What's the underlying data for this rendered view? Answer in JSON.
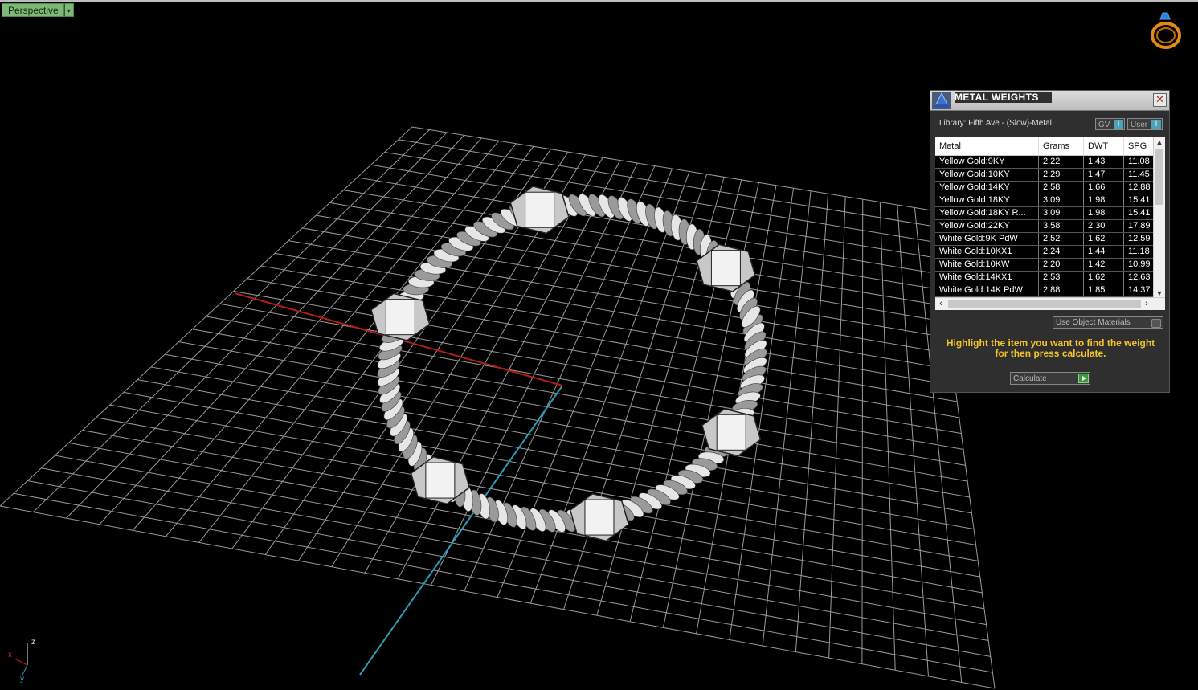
{
  "viewport": {
    "label": "Perspective",
    "dropdown_glyph": "▾",
    "axis": {
      "x": "x",
      "y": "y",
      "z": "z"
    },
    "logo_icon": "ring-icon"
  },
  "panel": {
    "title": "METAL WEIGHTS",
    "close_glyph": "✕",
    "library_label": "Library: Fifth Ave - (Slow)-Metal",
    "toggle_gv": "GV",
    "toggle_user": "User",
    "toggle_knob": "I",
    "columns": [
      "Metal",
      "Grams",
      "DWT",
      "SPG"
    ],
    "rows": [
      [
        "Yellow Gold:9KY",
        "2.22",
        "1.43",
        "11.08"
      ],
      [
        "Yellow Gold:10KY",
        "2.29",
        "1.47",
        "11.45"
      ],
      [
        "Yellow Gold:14KY",
        "2.58",
        "1.66",
        "12.88"
      ],
      [
        "Yellow Gold:18KY",
        "3.09",
        "1.98",
        "15.41"
      ],
      [
        "Yellow Gold:18KY R...",
        "3.09",
        "1.98",
        "15.41"
      ],
      [
        "Yellow Gold:22KY",
        "3.58",
        "2.30",
        "17.89"
      ],
      [
        "White Gold:9K PdW",
        "2.52",
        "1.62",
        "12.59"
      ],
      [
        "White Gold:10KX1",
        "2.24",
        "1.44",
        "11.18"
      ],
      [
        "White Gold:10KW",
        "2.20",
        "1.42",
        "10.99"
      ],
      [
        "White Gold:14KX1",
        "2.53",
        "1.62",
        "12.63"
      ],
      [
        "White Gold:14K PdW",
        "2.88",
        "1.85",
        "14.37"
      ]
    ],
    "use_object_materials": "Use Object Materials",
    "hint": "Highlight the item you want to find the weight for then press calculate.",
    "calculate_label": "Calculate",
    "accent_hint_color": "#f3c32a",
    "viewport_label_color": "#7db879"
  }
}
